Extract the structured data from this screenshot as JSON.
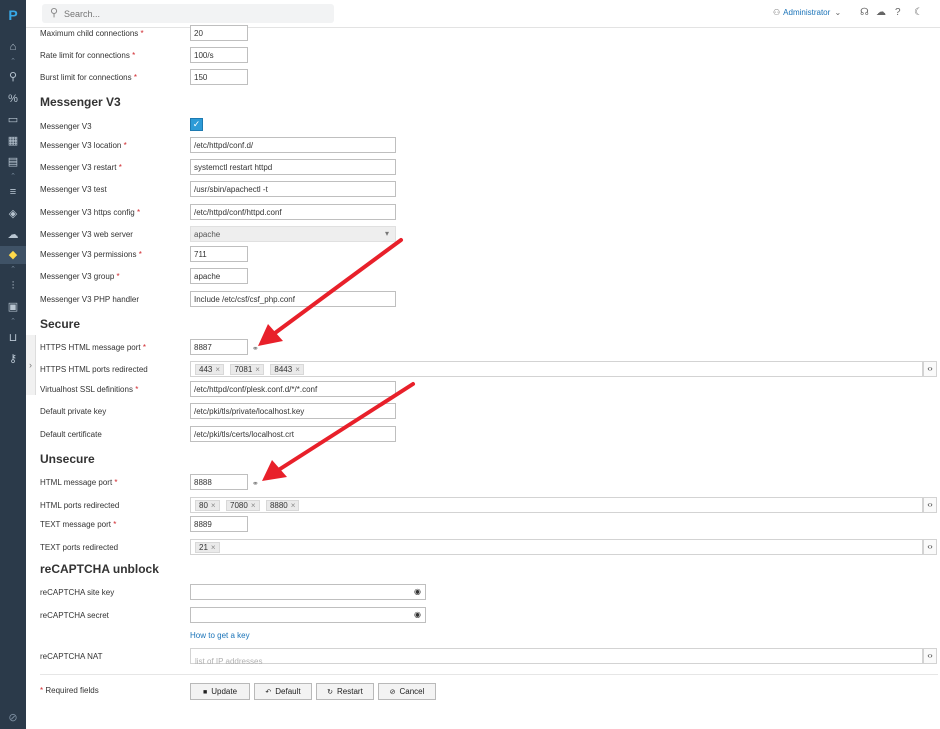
{
  "rail": {
    "logo": "P",
    "icons": [
      "home-icon",
      "user-icon",
      "percent-icon",
      "monitor-icon",
      "apps-icon",
      "book-icon",
      "list-icon",
      "shield-icon",
      "cloud-icon",
      "plugin-icon",
      "sliders-icon",
      "grid-icon",
      "basket-icon",
      "key-icon"
    ],
    "active_icon": "plugin-icon",
    "active_color": "#ffd94a"
  },
  "topbar": {
    "search_placeholder": "Search...",
    "user_label": "Administrator",
    "user_caret": "⌄",
    "icons": [
      "help-center-icon",
      "cloud-icon",
      "question-icon",
      "moon-icon"
    ]
  },
  "form": {
    "top_rows": [
      {
        "label": "Maximum child connections",
        "required": true,
        "value": "20"
      },
      {
        "label": "Rate limit for connections",
        "required": true,
        "value": "100/s"
      },
      {
        "label": "Burst limit for connections",
        "required": true,
        "value": "150"
      }
    ],
    "messenger": {
      "title": "Messenger V3",
      "enabled_label": "Messenger V3",
      "enabled": true,
      "rows": [
        {
          "label": "Messenger V3 location",
          "required": true,
          "value": "/etc/httpd/conf.d/"
        },
        {
          "label": "Messenger V3 restart",
          "required": true,
          "value": "systemctl restart httpd"
        },
        {
          "label": "Messenger V3 test",
          "required": false,
          "value": "/usr/sbin/apachectl -t"
        },
        {
          "label": "Messenger V3 https config",
          "required": true,
          "value": "/etc/httpd/conf/httpd.conf"
        },
        {
          "label": "Messenger V3 web server",
          "required": false,
          "value": "apache"
        },
        {
          "label": "Messenger V3 permissions",
          "required": true,
          "value": "711"
        },
        {
          "label": "Messenger V3 group",
          "required": true,
          "value": "apache"
        },
        {
          "label": "Messenger V3 PHP handler",
          "required": false,
          "value": "Include /etc/csf/csf_php.conf"
        }
      ]
    },
    "secure": {
      "title": "Secure",
      "port_label": "HTTPS HTML message port",
      "port_value": "8887",
      "redirect_label": "HTTPS HTML ports redirected",
      "redirect_tags": [
        "443",
        "7081",
        "8443"
      ],
      "ssl_label": "Virtualhost SSL definitions",
      "ssl_value": "/etc/httpd/conf/plesk.conf.d/*/*.conf",
      "key_label": "Default private key",
      "key_value": "/etc/pki/tls/private/localhost.key",
      "cert_label": "Default certificate",
      "cert_value": "/etc/pki/tls/certs/localhost.crt"
    },
    "unsecure": {
      "title": "Unsecure",
      "port_label": "HTML message port",
      "port_value": "8888",
      "redirect_label": "HTML ports redirected",
      "redirect_tags": [
        "80",
        "7080",
        "8880"
      ],
      "text_port_label": "TEXT message port",
      "text_port_value": "8889",
      "text_redirect_label": "TEXT ports redirected",
      "text_redirect_tags": [
        "21"
      ]
    },
    "recaptcha": {
      "title": "reCAPTCHA unblock",
      "site_key_label": "reCAPTCHA site key",
      "site_key_value": "",
      "secret_label": "reCAPTCHA secret",
      "secret_value": "",
      "how_link": "How to get a key",
      "nat_label": "reCAPTCHA NAT",
      "nat_placeholder": "list of IP addresses"
    },
    "required_star": "*",
    "required_note": "Required fields",
    "buttons": {
      "update": "Update",
      "default": "Default",
      "restart": "Restart",
      "cancel": "Cancel"
    }
  },
  "annotation_color": "#e8202a"
}
